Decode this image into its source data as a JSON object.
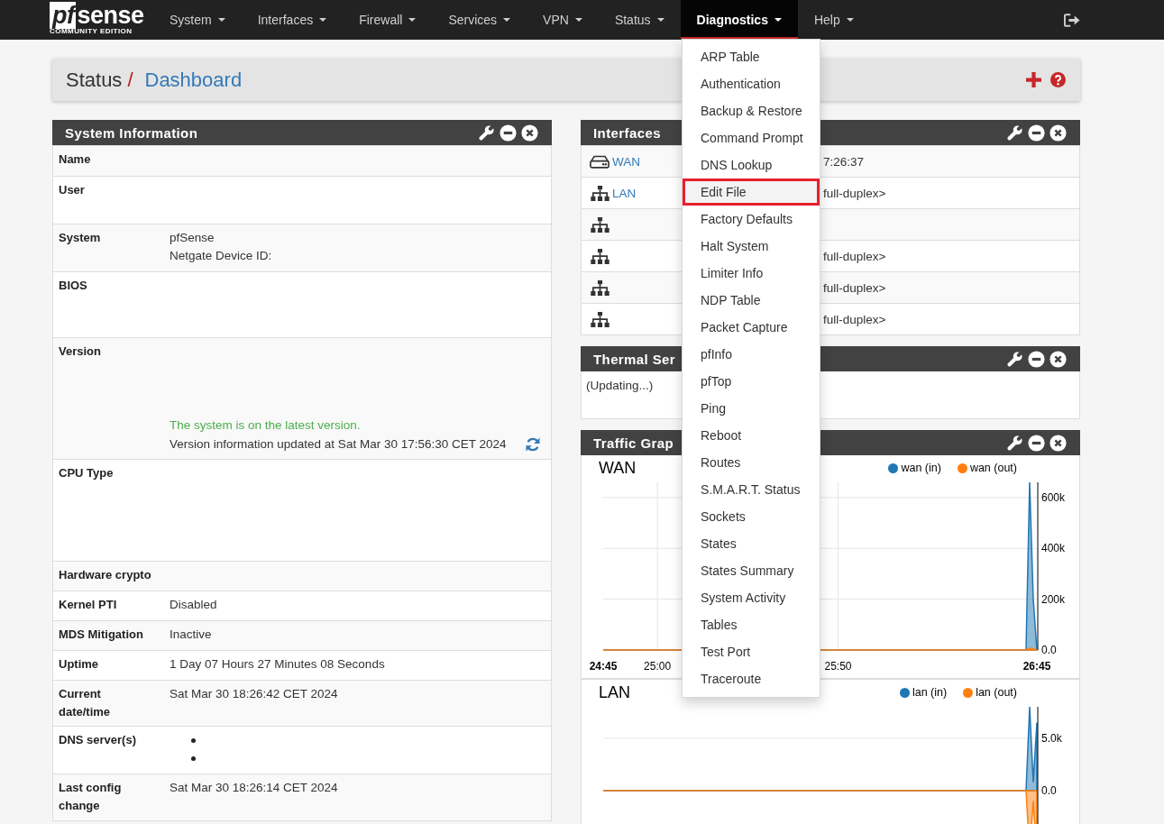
{
  "navbar": {
    "logo": {
      "mark": "pf",
      "name": "sense",
      "edition": "COMMUNITY EDITION"
    },
    "items": [
      {
        "label": "System",
        "selected": false
      },
      {
        "label": "Interfaces",
        "selected": false
      },
      {
        "label": "Firewall",
        "selected": false
      },
      {
        "label": "Services",
        "selected": false
      },
      {
        "label": "VPN",
        "selected": false
      },
      {
        "label": "Status",
        "selected": false
      },
      {
        "label": "Diagnostics",
        "selected": true
      },
      {
        "label": "Help",
        "selected": false
      }
    ]
  },
  "diagnostics_menu": {
    "items": [
      {
        "label": "ARP Table",
        "selected": false,
        "annotated": false
      },
      {
        "label": "Authentication",
        "selected": false,
        "annotated": false
      },
      {
        "label": "Backup & Restore",
        "selected": false,
        "annotated": false
      },
      {
        "label": "Command Prompt",
        "selected": false,
        "annotated": false
      },
      {
        "label": "DNS Lookup",
        "selected": false,
        "annotated": false
      },
      {
        "label": "Edit File",
        "selected": true,
        "annotated": true
      },
      {
        "label": "Factory Defaults",
        "selected": false,
        "annotated": false
      },
      {
        "label": "Halt System",
        "selected": false,
        "annotated": false
      },
      {
        "label": "Limiter Info",
        "selected": false,
        "annotated": false
      },
      {
        "label": "NDP Table",
        "selected": false,
        "annotated": false
      },
      {
        "label": "Packet Capture",
        "selected": false,
        "annotated": false
      },
      {
        "label": "pfInfo",
        "selected": false,
        "annotated": false
      },
      {
        "label": "pfTop",
        "selected": false,
        "annotated": false
      },
      {
        "label": "Ping",
        "selected": false,
        "annotated": false
      },
      {
        "label": "Reboot",
        "selected": false,
        "annotated": false
      },
      {
        "label": "Routes",
        "selected": false,
        "annotated": false
      },
      {
        "label": "S.M.A.R.T. Status",
        "selected": false,
        "annotated": false
      },
      {
        "label": "Sockets",
        "selected": false,
        "annotated": false
      },
      {
        "label": "States",
        "selected": false,
        "annotated": false
      },
      {
        "label": "States Summary",
        "selected": false,
        "annotated": false
      },
      {
        "label": "System Activity",
        "selected": false,
        "annotated": false
      },
      {
        "label": "Tables",
        "selected": false,
        "annotated": false
      },
      {
        "label": "Test Port",
        "selected": false,
        "annotated": false
      },
      {
        "label": "Traceroute",
        "selected": false,
        "annotated": false
      }
    ]
  },
  "breadcrumb": {
    "section": "Status",
    "separator": "/",
    "page": "Dashboard"
  },
  "system_information": {
    "title": "System Information",
    "rows": [
      {
        "kind": "text",
        "label": "Name"
      },
      {
        "kind": "text",
        "label": "User"
      },
      {
        "kind": "text",
        "label": "System",
        "lines": [
          "pfSense",
          "Netgate Device ID:"
        ]
      },
      {
        "kind": "text",
        "label": "BIOS"
      },
      {
        "kind": "version",
        "label": "Version",
        "notice": "The system is on the latest version.",
        "updated": "Version information updated at Sat Mar 30 17:56:30 CET 2024"
      },
      {
        "kind": "text",
        "label": "CPU Type"
      },
      {
        "kind": "text",
        "label": "Hardware crypto"
      },
      {
        "kind": "text",
        "label": "Kernel PTI",
        "lines": [
          "Disabled"
        ]
      },
      {
        "kind": "text",
        "label": "MDS Mitigation",
        "lines": [
          "Inactive"
        ]
      },
      {
        "kind": "text",
        "label": "Uptime",
        "lines": [
          "1 Day 07 Hours 27 Minutes 08 Seconds"
        ]
      },
      {
        "kind": "text",
        "label": "Current date/time",
        "lines": [
          "Sat Mar 30 18:26:42 CET 2024"
        ]
      },
      {
        "kind": "bullets",
        "label": "DNS server(s)",
        "items": [
          {
            "kind": "bullet"
          },
          {
            "kind": "bullet"
          }
        ]
      },
      {
        "kind": "text",
        "label": "Last config change",
        "lines": [
          "Sat Mar 30 18:26:14 CET 2024"
        ]
      }
    ]
  },
  "interfaces": {
    "title": "Interfaces",
    "rows": [
      {
        "kind": "wan",
        "name": "WAN",
        "detail": "7:26:37"
      },
      {
        "kind": "lan",
        "name": "LAN",
        "detail": "full-duplex>"
      },
      {
        "kind": "lan"
      },
      {
        "kind": "lan",
        "detail": "full-duplex>"
      },
      {
        "kind": "lan",
        "detail": "full-duplex>"
      },
      {
        "kind": "lan",
        "detail": "full-duplex>"
      }
    ]
  },
  "thermal_sensors": {
    "title": "Thermal Ser",
    "status": "(Updating...)"
  },
  "traffic_graphs": {
    "title": "Traffic Grap",
    "graphs": [
      {
        "title": "WAN",
        "chart_data": {
          "type": "area",
          "categories": [
            "24:45",
            null,
            null,
            null,
            null,
            null,
            null,
            null,
            null,
            null,
            null,
            null,
            null,
            null,
            null,
            "25:00",
            null,
            null,
            null,
            null,
            null,
            null,
            null,
            null,
            null,
            null,
            null,
            null,
            null,
            null,
            null,
            null,
            null,
            null,
            null,
            null,
            null,
            null,
            null,
            null,
            null,
            null,
            null,
            null,
            null,
            null,
            null,
            null,
            null,
            null,
            null,
            null,
            null,
            null,
            null,
            null,
            null,
            null,
            null,
            null,
            null,
            null,
            null,
            null,
            null,
            "25:50",
            null,
            null,
            null,
            null,
            null,
            null,
            null,
            null,
            null,
            null,
            null,
            null,
            null,
            null,
            null,
            null,
            null,
            null,
            null,
            null,
            null,
            null,
            null,
            null,
            null,
            null,
            null,
            null,
            null,
            null,
            null,
            null,
            null,
            null,
            null,
            null,
            null,
            null,
            null,
            null,
            null,
            null,
            null,
            null,
            null,
            null,
            null,
            null,
            null,
            null,
            null,
            null,
            null,
            null,
            "26:45"
          ],
          "series": [
            {
              "name": "wan (in)",
              "color": "#1f77b4",
              "values": [
                0,
                0,
                0,
                0,
                0,
                0,
                0,
                0,
                0,
                0,
                0,
                0,
                0,
                0,
                0,
                0,
                0,
                0,
                0,
                0,
                0,
                0,
                0,
                0,
                0,
                0,
                0,
                0,
                0,
                0,
                0,
                0,
                0,
                0,
                0,
                0,
                0,
                0,
                0,
                0,
                0,
                0,
                0,
                0,
                0,
                0,
                0,
                0,
                0,
                0,
                0,
                0,
                0,
                0,
                0,
                0,
                0,
                0,
                0,
                0,
                0,
                0,
                0,
                0,
                0,
                0,
                0,
                0,
                0,
                0,
                0,
                0,
                0,
                0,
                0,
                0,
                0,
                0,
                0,
                0,
                0,
                0,
                0,
                0,
                0,
                0,
                0,
                0,
                0,
                0,
                0,
                0,
                0,
                0,
                0,
                0,
                0,
                0,
                0,
                0,
                0,
                0,
                0,
                0,
                0,
                0,
                0,
                0,
                0,
                0,
                0,
                0,
                0,
                0,
                0,
                0,
                0,
                0,
                660000,
                200000,
                0
              ]
            },
            {
              "name": "wan (out)",
              "color": "#ff7f0e",
              "values": [
                0,
                0,
                0,
                0,
                0,
                0,
                0,
                0,
                0,
                0,
                0,
                0,
                0,
                0,
                0,
                0,
                0,
                0,
                0,
                0,
                0,
                0,
                0,
                0,
                0,
                0,
                0,
                0,
                0,
                0,
                0,
                0,
                0,
                0,
                0,
                0,
                0,
                0,
                0,
                0,
                0,
                0,
                0,
                0,
                0,
                0,
                0,
                0,
                0,
                0,
                0,
                0,
                0,
                0,
                0,
                0,
                0,
                0,
                0,
                0,
                0,
                0,
                0,
                0,
                0,
                0,
                0,
                0,
                0,
                0,
                0,
                0,
                0,
                0,
                0,
                0,
                0,
                0,
                0,
                0,
                0,
                0,
                0,
                0,
                0,
                0,
                0,
                0,
                0,
                0,
                0,
                0,
                0,
                0,
                0,
                0,
                0,
                0,
                0,
                0,
                0,
                0,
                0,
                0,
                0,
                0,
                0,
                0,
                0,
                0,
                0,
                0,
                0,
                0,
                0,
                0,
                0,
                0,
                8000,
                4000,
                0
              ]
            }
          ],
          "ylim": [
            0,
            660000
          ],
          "yticks": [
            {
              "value": 0,
              "label": "0.0"
            },
            {
              "value": 200000,
              "label": "200k"
            },
            {
              "value": 400000,
              "label": "400k"
            },
            {
              "value": 600000,
              "label": "600k"
            }
          ],
          "grid": true,
          "legend": true
        }
      },
      {
        "title": "LAN",
        "chart_data": {
          "type": "area",
          "categories": [
            null,
            null,
            null,
            null,
            null,
            null,
            null,
            null,
            null,
            null,
            null,
            null,
            null,
            null,
            null,
            null,
            null,
            null,
            null,
            null,
            null,
            null,
            null,
            null,
            null,
            null,
            null,
            null,
            null,
            null,
            null,
            null,
            null,
            null,
            null,
            null,
            null,
            null,
            null,
            null,
            null,
            null,
            null,
            null,
            null,
            null,
            null,
            null,
            null,
            null,
            null,
            null,
            null,
            null,
            null,
            null,
            null,
            null,
            null,
            null,
            null,
            null,
            null,
            null,
            null,
            null,
            null,
            null,
            null,
            null,
            null,
            null,
            null,
            null,
            null,
            null,
            null,
            null,
            null,
            null,
            null,
            null,
            null,
            null,
            null,
            null,
            null,
            null,
            null,
            null,
            null,
            null,
            null,
            null,
            null,
            null,
            null,
            null,
            null,
            null,
            null,
            null,
            null,
            null,
            null,
            null,
            null,
            null,
            null,
            null,
            null,
            null,
            null,
            null,
            null,
            null,
            null,
            null,
            null,
            null,
            null
          ],
          "series": [
            {
              "name": "lan (in)",
              "color": "#1f77b4",
              "values": [
                0,
                0,
                0,
                0,
                0,
                0,
                0,
                0,
                0,
                0,
                0,
                0,
                0,
                0,
                0,
                0,
                0,
                0,
                0,
                0,
                0,
                0,
                0,
                0,
                0,
                0,
                0,
                0,
                0,
                0,
                0,
                0,
                0,
                0,
                0,
                0,
                0,
                0,
                0,
                0,
                0,
                0,
                0,
                0,
                0,
                0,
                0,
                0,
                0,
                0,
                0,
                0,
                0,
                0,
                0,
                0,
                0,
                0,
                0,
                0,
                0,
                0,
                0,
                0,
                0,
                0,
                0,
                0,
                0,
                0,
                0,
                0,
                0,
                0,
                0,
                0,
                0,
                0,
                0,
                0,
                0,
                0,
                0,
                0,
                0,
                0,
                0,
                0,
                0,
                0,
                0,
                0,
                0,
                0,
                0,
                0,
                0,
                0,
                0,
                0,
                0,
                0,
                0,
                0,
                0,
                0,
                0,
                0,
                0,
                0,
                0,
                0,
                0,
                0,
                0,
                0,
                0,
                0,
                8000,
                800,
                6500
              ]
            },
            {
              "name": "lan (out)",
              "color": "#ff7f0e",
              "values": [
                0,
                0,
                0,
                0,
                0,
                0,
                0,
                0,
                0,
                0,
                0,
                0,
                0,
                0,
                0,
                0,
                0,
                0,
                0,
                0,
                0,
                0,
                0,
                0,
                0,
                0,
                0,
                0,
                0,
                0,
                0,
                0,
                0,
                0,
                0,
                0,
                0,
                0,
                0,
                0,
                0,
                0,
                0,
                0,
                0,
                0,
                0,
                0,
                0,
                0,
                0,
                0,
                0,
                0,
                0,
                0,
                0,
                0,
                0,
                0,
                0,
                0,
                0,
                0,
                0,
                0,
                0,
                0,
                0,
                0,
                0,
                0,
                0,
                0,
                0,
                0,
                0,
                0,
                0,
                0,
                0,
                0,
                0,
                0,
                0,
                0,
                0,
                0,
                0,
                0,
                0,
                0,
                0,
                0,
                0,
                0,
                0,
                0,
                0,
                0,
                0,
                0,
                0,
                0,
                0,
                0,
                0,
                0,
                0,
                0,
                0,
                0,
                0,
                0,
                0,
                0,
                0,
                0,
                -6000,
                -1000,
                -6000
              ]
            }
          ],
          "ylim": [
            -8000,
            8000
          ],
          "yticks": [
            {
              "value": 0,
              "label": "0.0"
            },
            {
              "value": 5000,
              "label": "5.0k"
            }
          ],
          "grid": true,
          "legend": true
        }
      }
    ]
  }
}
